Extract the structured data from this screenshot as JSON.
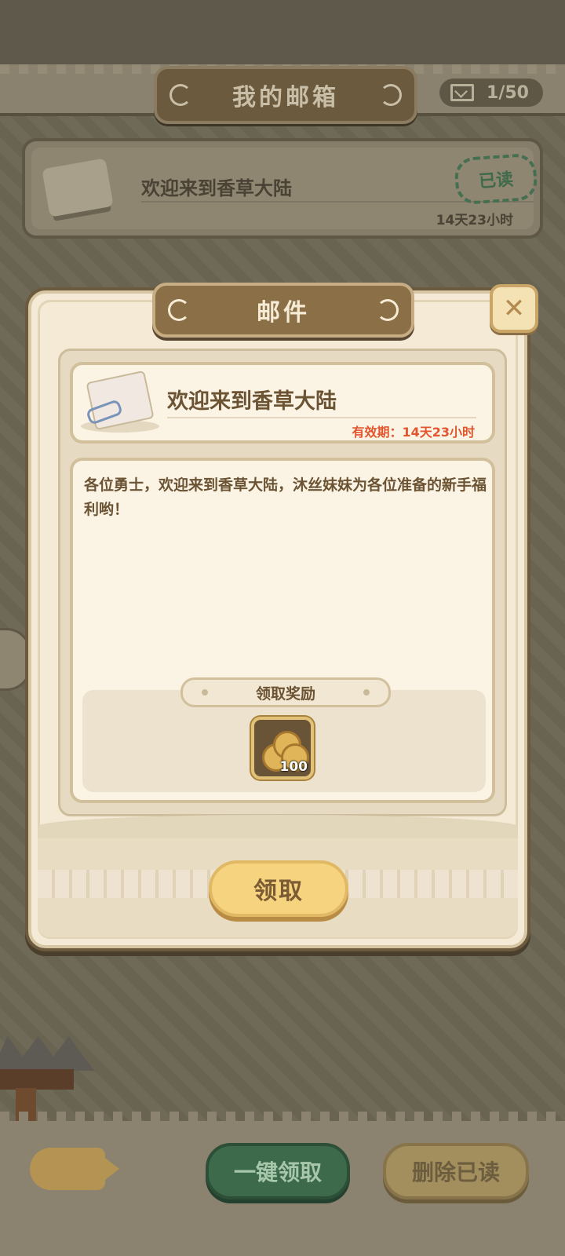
{
  "top": {
    "title": "我的邮箱",
    "mail_count": "1/50",
    "envelope_icon": "envelope-icon"
  },
  "mail_list": [
    {
      "subject": "欢迎来到香草大陆",
      "status": "已读",
      "time_left": "14天23小时"
    }
  ],
  "modal": {
    "title": "邮件",
    "close_icon": "close-icon",
    "subject": "欢迎来到香草大陆",
    "expiry": "有效期：14天23小时",
    "body": "各位勇士，欢迎来到香草大陆，沐丝妹妹为各位准备的新手福利哟！",
    "reward_tag": "领取奖励",
    "rewards": [
      {
        "icon": "gold-coins-icon",
        "qty": "100"
      }
    ],
    "claim_label": "领取"
  },
  "bottom": {
    "claim_all_label": "一键领取",
    "delete_read_label": "删除已读",
    "fish_icon": "fishbone-icon"
  },
  "colors": {
    "accent_brown": "#8a6f47",
    "expiry_red": "#e2552f",
    "claim_yellow": "#f6d37f",
    "claim_all_green": "#3e6a4c"
  }
}
